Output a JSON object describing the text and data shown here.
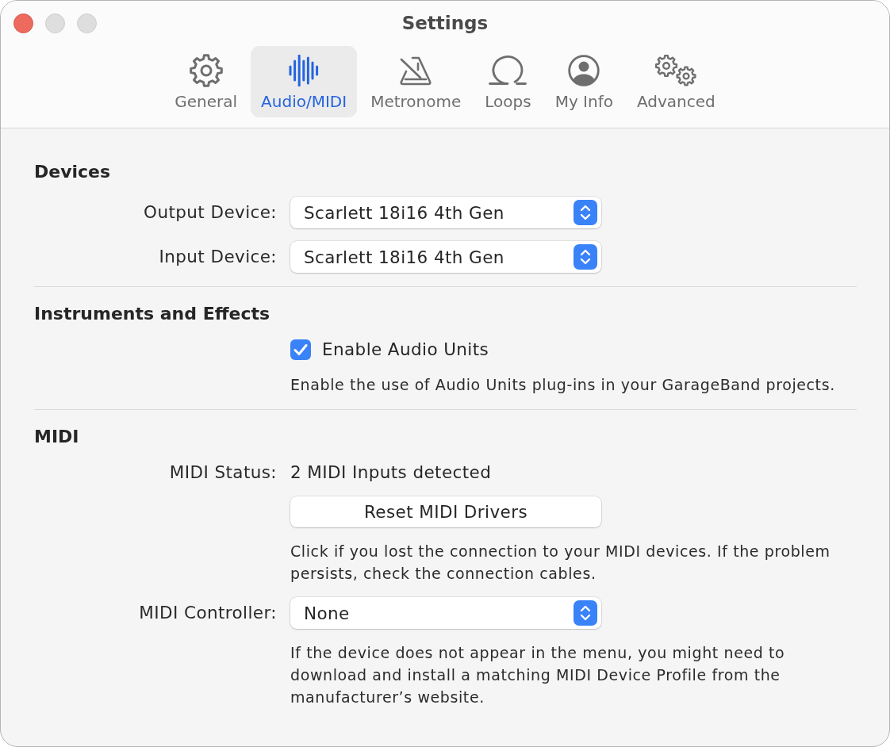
{
  "window": {
    "title": "Settings"
  },
  "tabs": [
    {
      "label": "General",
      "selected": false
    },
    {
      "label": "Audio/MIDI",
      "selected": true
    },
    {
      "label": "Metronome",
      "selected": false
    },
    {
      "label": "Loops",
      "selected": false
    },
    {
      "label": "My Info",
      "selected": false
    },
    {
      "label": "Advanced",
      "selected": false
    }
  ],
  "sections": [
    {
      "heading": "Devices",
      "rows": [
        {
          "kind": "popup",
          "label": "Output Device:",
          "value": "Scarlett 18i16 4th Gen"
        },
        {
          "kind": "popup",
          "label": "Input Device:",
          "value": "Scarlett 18i16 4th Gen"
        }
      ]
    },
    {
      "heading": "Instruments and Effects",
      "rows": [
        {
          "kind": "checkbox",
          "label": "Enable Audio Units",
          "checked": true
        },
        {
          "kind": "note",
          "text": "Enable the use of Audio Units plug-ins in your GarageBand projects."
        }
      ]
    },
    {
      "heading": "MIDI",
      "rows": [
        {
          "kind": "status",
          "label": "MIDI Status:",
          "value": "2 MIDI Inputs detected"
        },
        {
          "kind": "button",
          "label": "Reset MIDI Drivers"
        },
        {
          "kind": "note",
          "text": "Click if you lost the connection to your MIDI devices. If the problem persists, check the connection cables."
        },
        {
          "kind": "popup",
          "label": "MIDI Controller:",
          "value": "None"
        },
        {
          "kind": "note",
          "text": "If the device does not appear in the menu, you might need to download and install a matching MIDI Device Profile from the manufacturer’s website."
        }
      ]
    }
  ]
}
